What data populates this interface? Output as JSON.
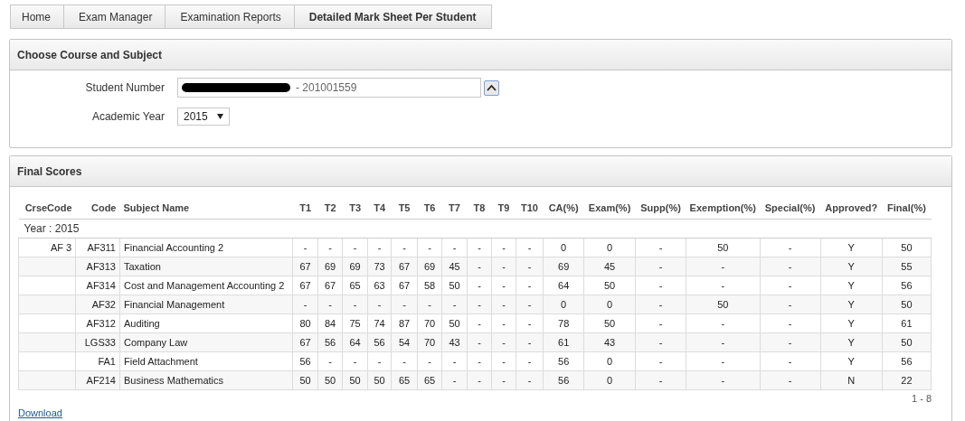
{
  "breadcrumbs": [
    {
      "label": "Home",
      "selected": false
    },
    {
      "label": "Exam Manager",
      "selected": false
    },
    {
      "label": "Examination Reports",
      "selected": false
    },
    {
      "label": "Detailed Mark Sheet Per Student",
      "selected": true
    }
  ],
  "course_panel": {
    "title": "Choose Course and Subject",
    "student_number": {
      "label": "Student Number",
      "value": "-  201001559",
      "redacted": true
    },
    "academic_year": {
      "label": "Academic Year",
      "value": "2015"
    }
  },
  "scores_panel": {
    "title": "Final Scores",
    "table": {
      "columns": [
        "CrseCode",
        "Code",
        "Subject Name",
        "T1",
        "T2",
        "T3",
        "T4",
        "T5",
        "T6",
        "T7",
        "T8",
        "T9",
        "T10",
        "CA(%)",
        "Exam(%)",
        "Supp(%)",
        "Exemption(%)",
        "Special(%)",
        "Approved?",
        "Final(%)"
      ],
      "group": "Year : 2015",
      "rows": [
        [
          "AF 3",
          "AF311",
          "Financial Accounting 2",
          "-",
          "-",
          "-",
          "-",
          "-",
          "-",
          "-",
          "-",
          "-",
          "-",
          "0",
          "0",
          "-",
          "50",
          "-",
          "Y",
          "50"
        ],
        [
          "",
          "AF313",
          "Taxation",
          "67",
          "69",
          "69",
          "73",
          "67",
          "69",
          "45",
          "-",
          "-",
          "-",
          "69",
          "45",
          "-",
          "-",
          "-",
          "Y",
          "55"
        ],
        [
          "",
          "AF314",
          "Cost and Management Accounting 2",
          "67",
          "67",
          "65",
          "63",
          "67",
          "58",
          "50",
          "-",
          "-",
          "-",
          "64",
          "50",
          "-",
          "-",
          "-",
          "Y",
          "56"
        ],
        [
          "",
          "AF32",
          "Financial Management",
          "-",
          "-",
          "-",
          "-",
          "-",
          "-",
          "-",
          "-",
          "-",
          "-",
          "0",
          "0",
          "-",
          "50",
          "-",
          "Y",
          "50"
        ],
        [
          "",
          "AF312",
          "Auditing",
          "80",
          "84",
          "75",
          "74",
          "87",
          "70",
          "50",
          "-",
          "-",
          "-",
          "78",
          "50",
          "-",
          "-",
          "-",
          "Y",
          "61"
        ],
        [
          "",
          "LGS33",
          "Company Law",
          "67",
          "56",
          "64",
          "56",
          "54",
          "70",
          "43",
          "-",
          "-",
          "-",
          "61",
          "43",
          "-",
          "-",
          "-",
          "Y",
          "50"
        ],
        [
          "",
          "FA1",
          "Field Attachment",
          "56",
          "-",
          "-",
          "-",
          "-",
          "-",
          "-",
          "-",
          "-",
          "-",
          "56",
          "0",
          "-",
          "-",
          "-",
          "Y",
          "56"
        ],
        [
          "",
          "AF214",
          "Business Mathematics",
          "50",
          "50",
          "50",
          "50",
          "65",
          "65",
          "-",
          "-",
          "-",
          "-",
          "56",
          "0",
          "-",
          "-",
          "-",
          "N",
          "22"
        ]
      ],
      "pagination": "1 - 8"
    },
    "download": "Download"
  }
}
